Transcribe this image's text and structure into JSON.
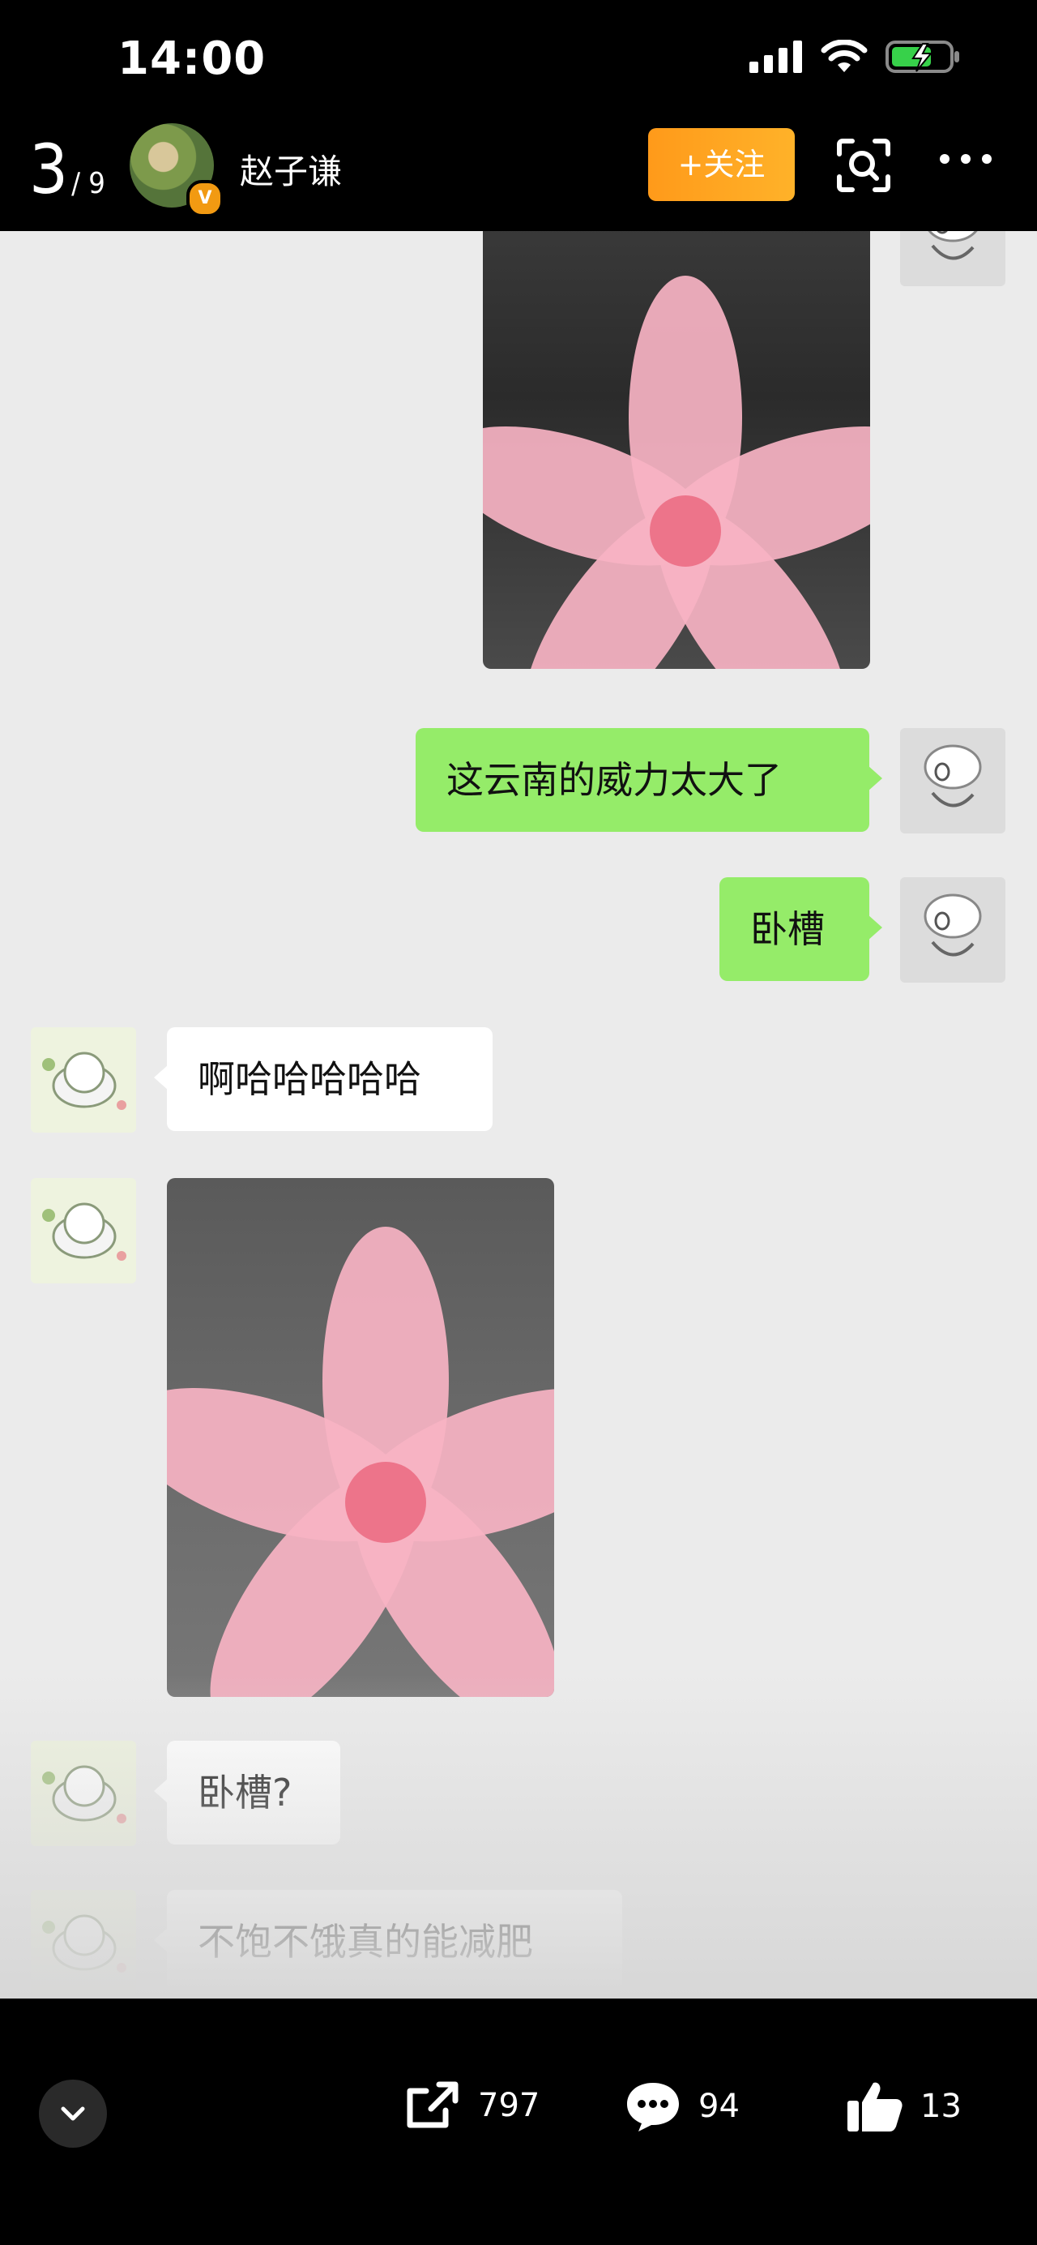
{
  "status_bar": {
    "time": "14:00"
  },
  "header": {
    "counter_current": "3",
    "counter_total": "/ 9",
    "username": "赵子谦",
    "verified_badge": "V",
    "follow_label": "+关注"
  },
  "messages": {
    "m1": "这云南的威力太大了",
    "m2": "卧槽",
    "m3": "啊哈哈哈哈哈",
    "m4": "卧槽?",
    "m5": "不饱不饿真的能减肥"
  },
  "actions": {
    "share_count": "797",
    "comment_count": "94",
    "like_count": "13"
  },
  "colors": {
    "sent_bubble": "#95ec69",
    "received_bubble": "#ffffff",
    "chat_background": "#ebebeb",
    "follow_button": "#ff9f1c"
  },
  "icons": [
    "signal-icon",
    "wifi-icon",
    "battery-icon",
    "scan-icon",
    "more-icon",
    "share-icon",
    "comment-icon",
    "like-icon",
    "chevron-down-icon"
  ]
}
